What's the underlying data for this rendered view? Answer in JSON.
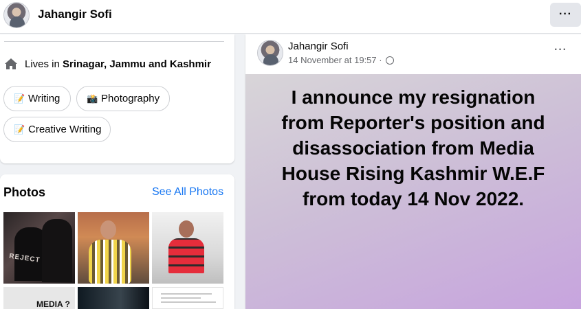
{
  "header": {
    "name": "Jahangir Sofi",
    "more_label": "···"
  },
  "intro": {
    "lives_prefix": "Lives in ",
    "lives_location": "Srinagar, Jammu and Kashmir",
    "chips": [
      {
        "emoji": "📝",
        "label": "Writing"
      },
      {
        "emoji": "📸",
        "label": "Photography"
      },
      {
        "emoji": "📝",
        "label": "Creative Writing"
      }
    ]
  },
  "photos": {
    "title": "Photos",
    "see_all": "See All Photos",
    "thumb_texts": {
      "t1": "REJECT NIKT",
      "t4": "MEDIA ?"
    }
  },
  "post": {
    "author": "Jahangir Sofi",
    "time": "14 November at 19:57 · ",
    "privacy_icon": "globe-icon",
    "more_label": "···",
    "text_lines": [
      "I announce my resignation",
      "from Reporter's position and",
      "disassociation from Media",
      "House Rising Kashmir W.E.F",
      "from today 14 Nov 2022."
    ]
  },
  "icons": {
    "home": "home-icon",
    "globe": "globe-icon"
  },
  "colors": {
    "link_blue": "#1877f2",
    "muted_text": "#65676b",
    "background": "#f0f2f5",
    "post_background_start": "#d8d5d8",
    "post_background_end": "#c7a4de"
  }
}
